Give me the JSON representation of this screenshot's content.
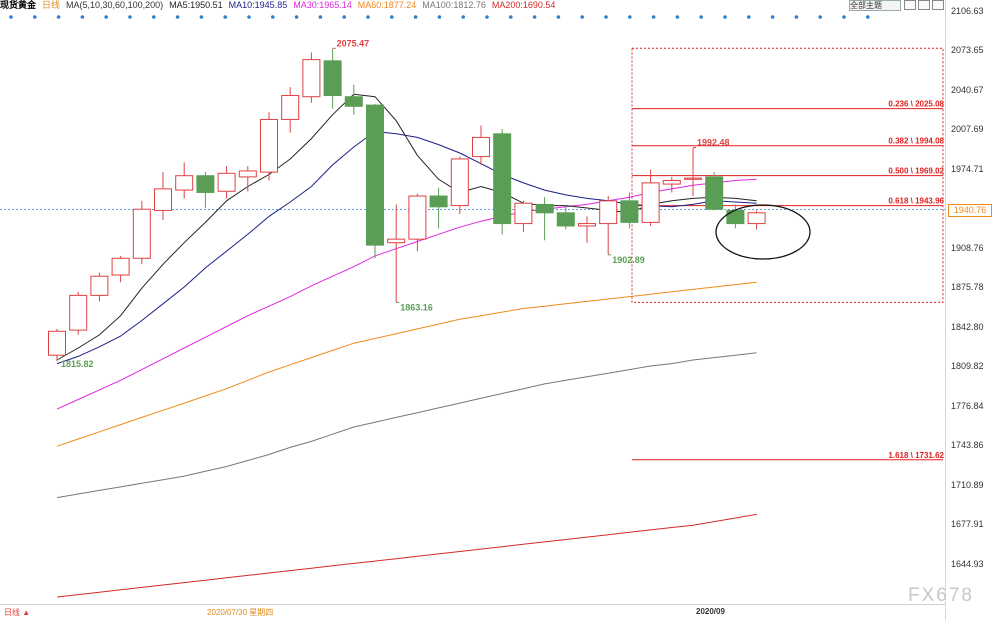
{
  "header": {
    "instrument": "现货黄金",
    "period": "日线",
    "ma_spec": "MA(5,10,30,60,100,200)",
    "ma5": "MA5:1950.51",
    "ma10": "MA10:1945.85",
    "ma30": "MA30:1965.14",
    "ma60": "MA60:1877.24",
    "ma100": "MA100:1812.76",
    "ma200": "MA200:1690.54",
    "main_button": "全部主题"
  },
  "colors": {
    "up": "#e04040",
    "down": "#5a9e56",
    "ma5": "#222222",
    "ma10": "#1a1f8a",
    "ma30": "#e028e0",
    "ma60": "#f08a1c",
    "ma100": "#777777",
    "ma200": "#d42a2a",
    "fib": "#e02020"
  },
  "footer": {
    "period_label": "日线 ▲",
    "date_label": "2020/07/30 星期四",
    "month_label": "2020/09"
  },
  "watermark": "FX678",
  "current_price_label": "1940.76",
  "chart_data": {
    "type": "candlestick",
    "y_ticks": [
      "2106.63",
      "2073.65",
      "2040.67",
      "2007.69",
      "1974.71",
      "1941.73",
      "1908.76",
      "1875.78",
      "1842.80",
      "1809.82",
      "1776.84",
      "1743.86",
      "1710.89",
      "1677.91",
      "1644.93"
    ],
    "ylim": [
      1611.95,
      2106.63
    ],
    "current_price": 1940.76,
    "candles": [
      {
        "o": 1819,
        "h": 1841,
        "l": 1814,
        "c": 1839
      },
      {
        "o": 1840,
        "h": 1872,
        "l": 1836,
        "c": 1869
      },
      {
        "o": 1869,
        "h": 1888,
        "l": 1864,
        "c": 1885
      },
      {
        "o": 1886,
        "h": 1902,
        "l": 1880,
        "c": 1900
      },
      {
        "o": 1900,
        "h": 1948,
        "l": 1895,
        "c": 1941
      },
      {
        "o": 1940,
        "h": 1972,
        "l": 1932,
        "c": 1958
      },
      {
        "o": 1957,
        "h": 1980,
        "l": 1950,
        "c": 1969
      },
      {
        "o": 1969,
        "h": 1972,
        "l": 1942,
        "c": 1955
      },
      {
        "o": 1956,
        "h": 1977,
        "l": 1950,
        "c": 1971
      },
      {
        "o": 1968,
        "h": 1977,
        "l": 1956,
        "c": 1973
      },
      {
        "o": 1972,
        "h": 2022,
        "l": 1965,
        "c": 2016
      },
      {
        "o": 2016,
        "h": 2043,
        "l": 2005,
        "c": 2036
      },
      {
        "o": 2035,
        "h": 2072,
        "l": 2030,
        "c": 2066
      },
      {
        "o": 2065,
        "h": 2075,
        "l": 2025,
        "c": 2036
      },
      {
        "o": 2035,
        "h": 2045,
        "l": 2020,
        "c": 2027
      },
      {
        "o": 2028,
        "h": 2029,
        "l": 1900,
        "c": 1911
      },
      {
        "o": 1913,
        "h": 1945,
        "l": 1863,
        "c": 1916
      },
      {
        "o": 1916,
        "h": 1954,
        "l": 1906,
        "c": 1952
      },
      {
        "o": 1952,
        "h": 1959,
        "l": 1925,
        "c": 1943
      },
      {
        "o": 1944,
        "h": 1985,
        "l": 1937,
        "c": 1983
      },
      {
        "o": 1985,
        "h": 2011,
        "l": 1978,
        "c": 2001
      },
      {
        "o": 2004,
        "h": 2008,
        "l": 1920,
        "c": 1929
      },
      {
        "o": 1929,
        "h": 1948,
        "l": 1922,
        "c": 1946
      },
      {
        "o": 1945,
        "h": 1951,
        "l": 1915,
        "c": 1938
      },
      {
        "o": 1938,
        "h": 1944,
        "l": 1924,
        "c": 1927
      },
      {
        "o": 1927,
        "h": 1935,
        "l": 1913,
        "c": 1929
      },
      {
        "o": 1929,
        "h": 1952,
        "l": 1903,
        "c": 1948
      },
      {
        "o": 1948,
        "h": 1955,
        "l": 1925,
        "c": 1930
      },
      {
        "o": 1930,
        "h": 1974,
        "l": 1927,
        "c": 1963
      },
      {
        "o": 1962,
        "h": 1968,
        "l": 1955,
        "c": 1965
      },
      {
        "o": 1966,
        "h": 1992,
        "l": 1952,
        "c": 1967
      },
      {
        "o": 1968,
        "h": 1972,
        "l": 1940,
        "c": 1941
      },
      {
        "o": 1940,
        "h": 1945,
        "l": 1925,
        "c": 1929
      },
      {
        "o": 1929,
        "h": 1940,
        "l": 1924,
        "c": 1938
      }
    ],
    "ma": {
      "ma5": [
        1815,
        1825,
        1836,
        1852,
        1875,
        1895,
        1913,
        1930,
        1948,
        1960,
        1970,
        1983,
        2000,
        2020,
        2037,
        2035,
        2015,
        1986,
        1966,
        1955,
        1960,
        1955,
        1946,
        1944,
        1944,
        1942,
        1940,
        1938,
        1945,
        1948,
        1950,
        1951,
        1950,
        1948
      ],
      "ma10": [
        1812,
        1818,
        1826,
        1835,
        1848,
        1862,
        1876,
        1892,
        1906,
        1920,
        1935,
        1947,
        1960,
        1978,
        1993,
        2006,
        2004,
        2001,
        1995,
        1988,
        1979,
        1970,
        1963,
        1957,
        1953,
        1950,
        1948,
        1945,
        1944,
        1943,
        1945,
        1948,
        1947,
        1946
      ],
      "ma30": [
        1774,
        1782,
        1790,
        1798,
        1807,
        1816,
        1825,
        1834,
        1843,
        1852,
        1860,
        1868,
        1877,
        1885,
        1893,
        1902,
        1908,
        1914,
        1920,
        1926,
        1931,
        1935,
        1939,
        1941,
        1943,
        1945,
        1948,
        1951,
        1955,
        1958,
        1961,
        1963,
        1965,
        1966
      ],
      "ma60": [
        1743,
        1749,
        1755,
        1761,
        1767,
        1773,
        1779,
        1785,
        1791,
        1798,
        1805,
        1811,
        1817,
        1823,
        1829,
        1833,
        1837,
        1841,
        1845,
        1849,
        1852,
        1855,
        1858,
        1860,
        1862,
        1864,
        1866,
        1868,
        1870,
        1872,
        1874,
        1876,
        1878,
        1880
      ],
      "ma100": [
        1700,
        1703,
        1706,
        1709,
        1712,
        1715,
        1718,
        1722,
        1726,
        1731,
        1736,
        1742,
        1747,
        1753,
        1759,
        1763,
        1767,
        1771,
        1775,
        1779,
        1783,
        1787,
        1791,
        1795,
        1798,
        1801,
        1804,
        1807,
        1810,
        1812,
        1815,
        1817,
        1819,
        1821
      ],
      "ma200": [
        1617,
        1619,
        1621,
        1623,
        1625,
        1627,
        1629,
        1631,
        1633,
        1635,
        1637,
        1639,
        1641,
        1643,
        1645,
        1647,
        1649,
        1651,
        1653,
        1655,
        1657,
        1659,
        1661,
        1663,
        1665,
        1667,
        1669,
        1671,
        1673,
        1675,
        1677,
        1680,
        1683,
        1686
      ]
    },
    "annotations": [
      {
        "candle": 13,
        "price": 2075.47,
        "text": "2075.47",
        "color": "#e04040",
        "pos": "above"
      },
      {
        "candle": 0,
        "price": 1815.82,
        "text": "1815.82",
        "color": "#5a9e56",
        "pos": "below"
      },
      {
        "candle": 16,
        "price": 1863.16,
        "text": "1863.16",
        "color": "#5a9e56",
        "pos": "below"
      },
      {
        "candle": 26,
        "price": 1902.89,
        "text": "1902.89",
        "color": "#5a9e56",
        "pos": "below"
      },
      {
        "candle": 30,
        "price": 1992.48,
        "text": "1992.48",
        "color": "#e04040",
        "pos": "above"
      }
    ],
    "fibonacci": [
      {
        "label": "0.236 \\ 2025.08",
        "price": 2025.08
      },
      {
        "label": "0.382 \\ 1994.08",
        "price": 1994.08
      },
      {
        "label": "0.500 \\ 1969.02",
        "price": 1969.02
      },
      {
        "label": "0.618 \\ 1943.96",
        "price": 1943.96
      },
      {
        "label": "1.618 \\ 1731.62",
        "price": 1731.62
      }
    ],
    "fib_range": [
      1863.16,
      2075.47
    ]
  }
}
